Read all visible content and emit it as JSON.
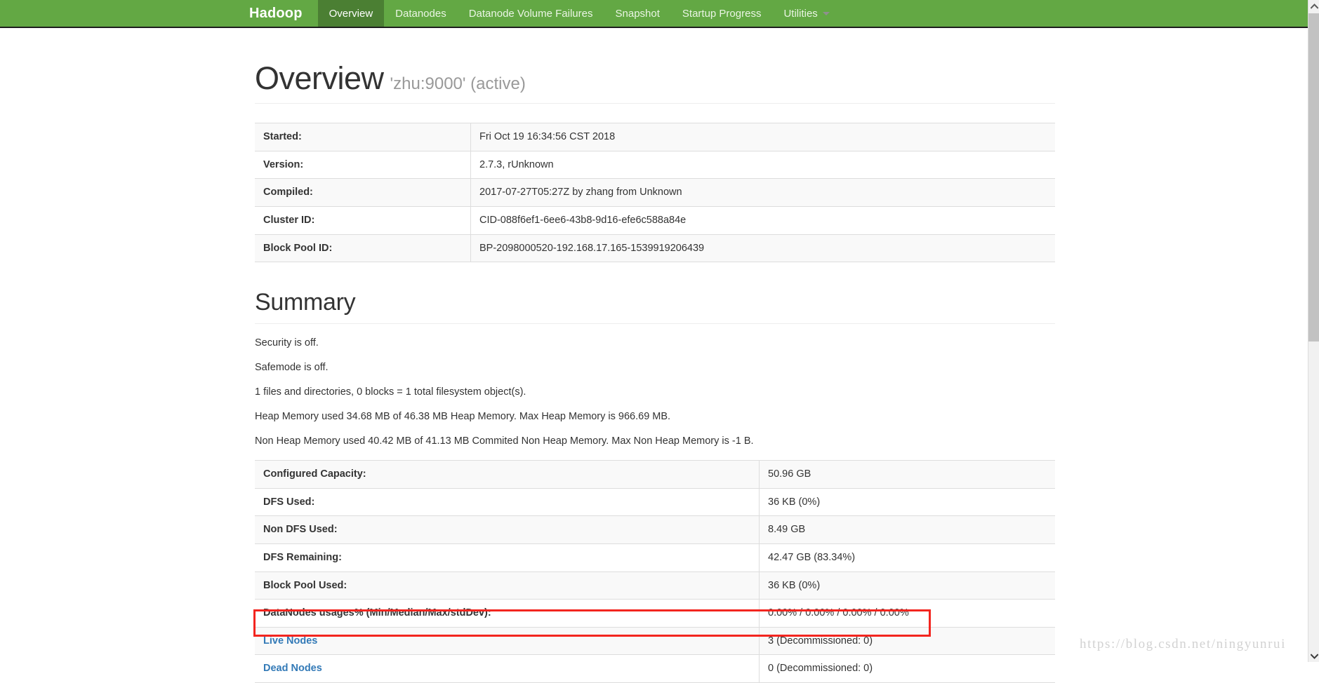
{
  "navbar": {
    "brand": "Hadoop",
    "items": [
      {
        "label": "Overview",
        "name": "nav-overview",
        "active": true
      },
      {
        "label": "Datanodes",
        "name": "nav-datanodes",
        "active": false
      },
      {
        "label": "Datanode Volume Failures",
        "name": "nav-datanode-volume-failures",
        "active": false
      },
      {
        "label": "Snapshot",
        "name": "nav-snapshot",
        "active": false
      },
      {
        "label": "Startup Progress",
        "name": "nav-startup-progress",
        "active": false
      },
      {
        "label": "Utilities",
        "name": "nav-utilities",
        "active": false,
        "caret": true
      }
    ],
    "accent_color": "#63a844",
    "active_color": "#4b7f33"
  },
  "page": {
    "title": "Overview",
    "subtitle": "'zhu:9000' (active)"
  },
  "startup_table": {
    "rows": [
      {
        "key": "Started:",
        "value": "Fri Oct 19 16:34:56 CST 2018"
      },
      {
        "key": "Version:",
        "value": "2.7.3, rUnknown"
      },
      {
        "key": "Compiled:",
        "value": "2017-07-27T05:27Z by zhang from Unknown"
      },
      {
        "key": "Cluster ID:",
        "value": "CID-088f6ef1-6ee6-43b8-9d16-efe6c588a84e"
      },
      {
        "key": "Block Pool ID:",
        "value": "BP-2098000520-192.168.17.165-1539919206439"
      }
    ]
  },
  "summary": {
    "heading": "Summary",
    "lines": [
      "Security is off.",
      "Safemode is off.",
      "1 files and directories, 0 blocks = 1 total filesystem object(s).",
      "Heap Memory used 34.68 MB of 46.38 MB Heap Memory. Max Heap Memory is 966.69 MB.",
      "Non Heap Memory used 40.42 MB of 41.13 MB Commited Non Heap Memory. Max Non Heap Memory is -1 B."
    ],
    "table": {
      "rows": [
        {
          "key": "Configured Capacity:",
          "value": "50.96 GB",
          "link": false
        },
        {
          "key": "DFS Used:",
          "value": "36 KB (0%)",
          "link": false
        },
        {
          "key": "Non DFS Used:",
          "value": "8.49 GB",
          "link": false
        },
        {
          "key": "DFS Remaining:",
          "value": "42.47 GB (83.34%)",
          "link": false
        },
        {
          "key": "Block Pool Used:",
          "value": "36 KB (0%)",
          "link": false
        },
        {
          "key": "DataNodes usages% (Min/Median/Max/stdDev):",
          "value": "0.00% / 0.00% / 0.00% / 0.00%",
          "link": false
        },
        {
          "key": "Live Nodes",
          "value": "3 (Decommissioned: 0)",
          "link": true
        },
        {
          "key": "Dead Nodes",
          "value": "0 (Decommissioned: 0)",
          "link": true
        }
      ]
    }
  },
  "annotation": {
    "highlight_target": "Live Nodes",
    "highlight_color": "#f3251f"
  },
  "watermark": {
    "text": "https://blog.csdn.net/ningyunrui"
  },
  "scrollbar": {
    "up_arrow": "chevron-up-icon",
    "down_arrow": "chevron-down-icon"
  }
}
